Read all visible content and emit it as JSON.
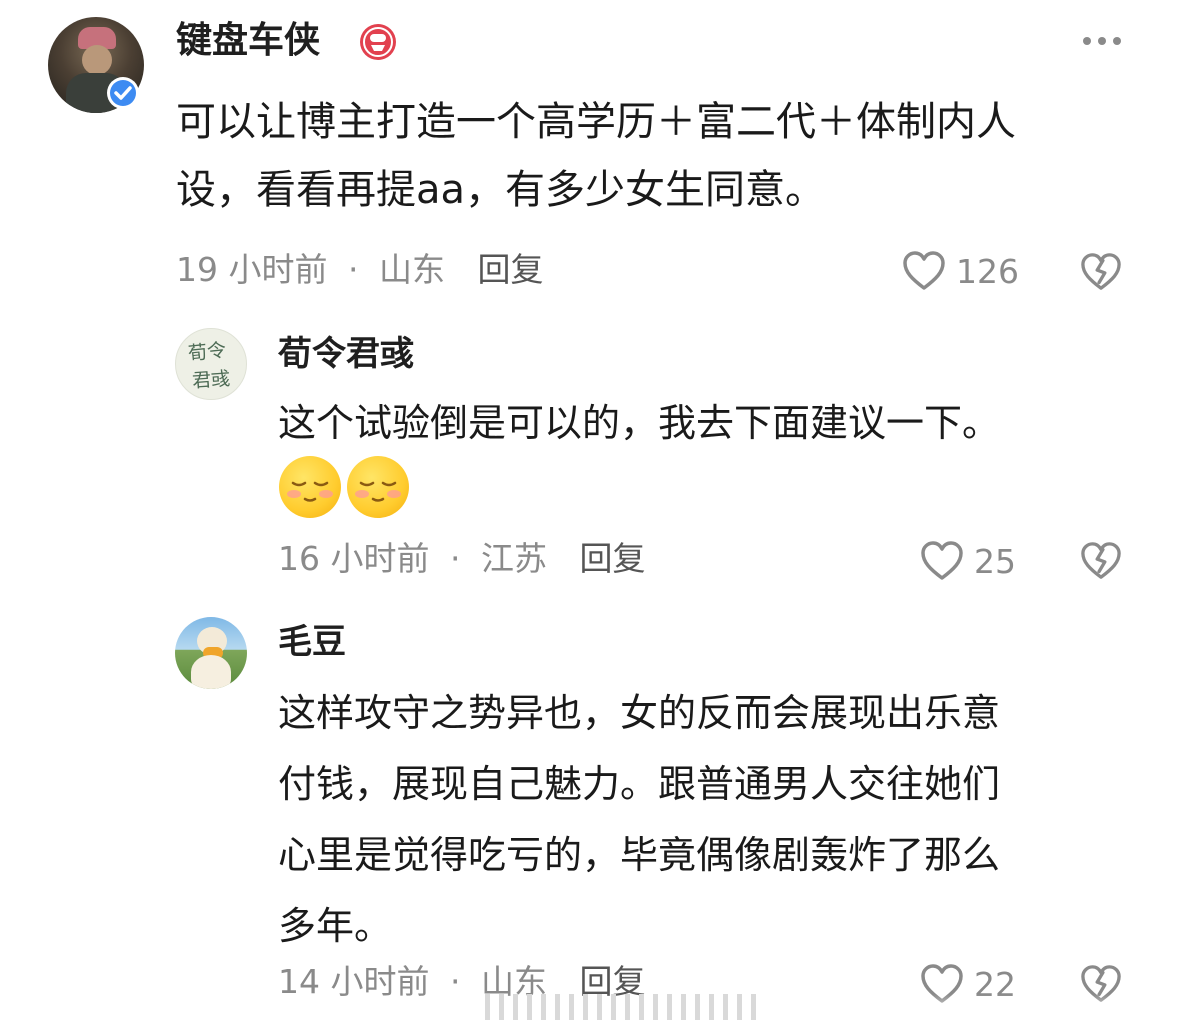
{
  "comments": [
    {
      "author": "键盘车侠",
      "text_lines": [
        "可以让博主打造一个高学历＋富二代＋体制内人",
        "设，看看再提aa，有多少女生同意。"
      ],
      "time": "19 小时前",
      "location": "山东",
      "reply_label": "回复",
      "likes": "126",
      "verified": true
    },
    {
      "author": "荀令君彧",
      "avatar_text": [
        "荀令",
        "君彧"
      ],
      "text_lines": [
        "这个试验倒是可以的，我去下面建议一下。"
      ],
      "emojis": [
        "smile-blush",
        "smile-blush"
      ],
      "time": "16 小时前",
      "location": "江苏",
      "reply_label": "回复",
      "likes": "25"
    },
    {
      "author": "毛豆",
      "text_lines": [
        "这样攻守之势异也，女的反而会展现出乐意",
        "付钱，展现自己魅力。跟普通男人交往她们",
        "心里是觉得吃亏的，毕竟偶像剧轰炸了那么",
        "多年。"
      ],
      "time": "14 小时前",
      "location": "山东",
      "reply_label": "回复",
      "likes": "22"
    }
  ],
  "separator": "·",
  "colors": {
    "badge": "#e2414f",
    "verified": "#3d8bf2",
    "meta": "#8a8a8a"
  },
  "icons": [
    "more-icon",
    "heart-icon",
    "dislike-icon",
    "verified-icon",
    "member-badge-icon"
  ]
}
